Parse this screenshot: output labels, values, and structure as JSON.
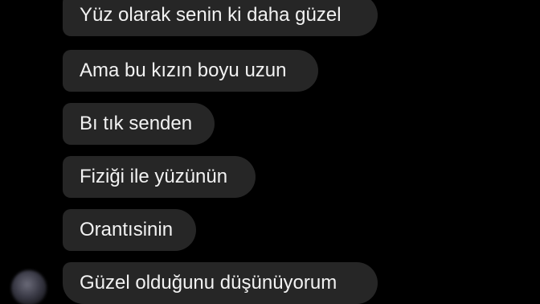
{
  "chat": {
    "messages": [
      {
        "text": "Yüz olarak senin ki daha güzel"
      },
      {
        "text": "Ama bu kızın boyu uzun"
      },
      {
        "text": "Bı tık senden"
      },
      {
        "text": "Fiziği ile yüzünün"
      },
      {
        "text": "Orantısinin"
      },
      {
        "text": "Güzel olduğunu düşünüyorum"
      }
    ]
  },
  "colors": {
    "background": "#000000",
    "bubble": "#262626",
    "text": "#f2f2f2"
  }
}
